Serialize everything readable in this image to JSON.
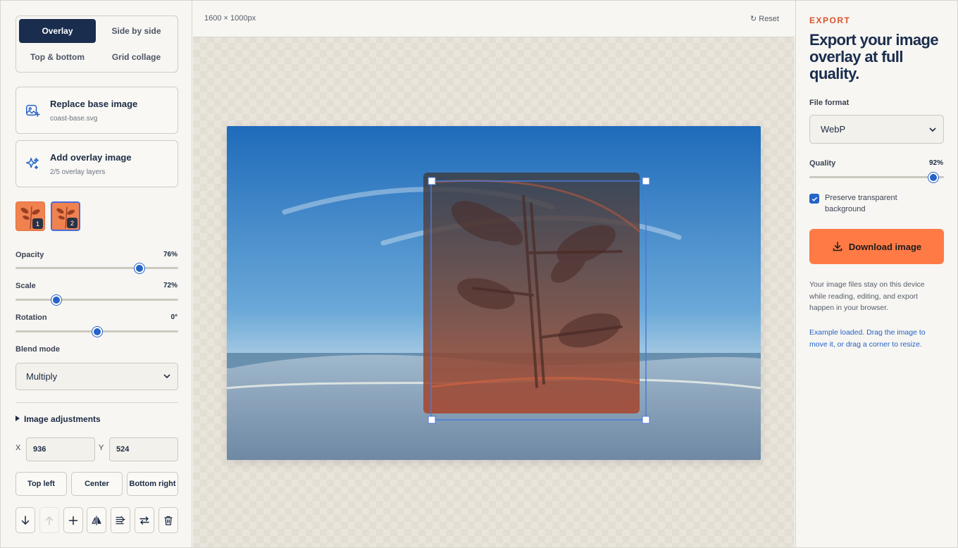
{
  "layout_modes": {
    "overlay": "Overlay",
    "side_by_side": "Side by side",
    "top_bottom": "Top & bottom",
    "grid_collage": "Grid collage",
    "active": "Overlay"
  },
  "replace_card": {
    "title": "Replace base image",
    "subtitle": "coast-base.svg"
  },
  "add_card": {
    "title": "Add overlay image",
    "subtitle": "2/5 overlay layers"
  },
  "layers": [
    {
      "number": "1"
    },
    {
      "number": "2",
      "selected": true
    }
  ],
  "controls": {
    "opacity": {
      "label": "Opacity",
      "value": "76%",
      "fraction": 0.76
    },
    "scale": {
      "label": "Scale",
      "value": "72%",
      "fraction": 0.25
    },
    "rotation": {
      "label": "Rotation",
      "value": "0°",
      "fraction": 0.5
    }
  },
  "blend": {
    "label": "Blend mode",
    "value": "Multiply"
  },
  "adjustments": {
    "label": "Image adjustments"
  },
  "position": {
    "x_label": "X",
    "x_value": "936",
    "y_label": "Y",
    "y_value": "524"
  },
  "position_buttons": {
    "top_left": "Top left",
    "center": "Center",
    "bottom_right": "Bottom right"
  },
  "toolbar": {
    "icons": [
      "arrow-down-icon",
      "arrow-up-icon",
      "plus-icon",
      "flip-horizontal-icon",
      "flip-vertical-icon",
      "swap-icon",
      "trash-icon"
    ]
  },
  "canvas_header": {
    "dimensions": "1600 × 1000px",
    "reset_label": "Reset"
  },
  "export": {
    "eyebrow": "EXPORT",
    "heading": "Export your image overlay at full quality.",
    "format_label": "File format",
    "format_value": "WebP",
    "quality_label": "Quality",
    "quality_value": "92%",
    "quality_fraction": 0.92,
    "preserve_label": "Preserve transparent background",
    "preserve_checked": true,
    "download_label": "Download image",
    "info_text": "Your image files stay on this device while reading, editing, and export happen in your browser.",
    "hint_text": "Example loaded. Drag the image to move it, or drag a corner to resize."
  },
  "colors": {
    "navy": "#1a2d4e",
    "accent_orange": "#ff7a45",
    "eyebrow_orange": "#d9542b",
    "blue": "#2563c8"
  }
}
